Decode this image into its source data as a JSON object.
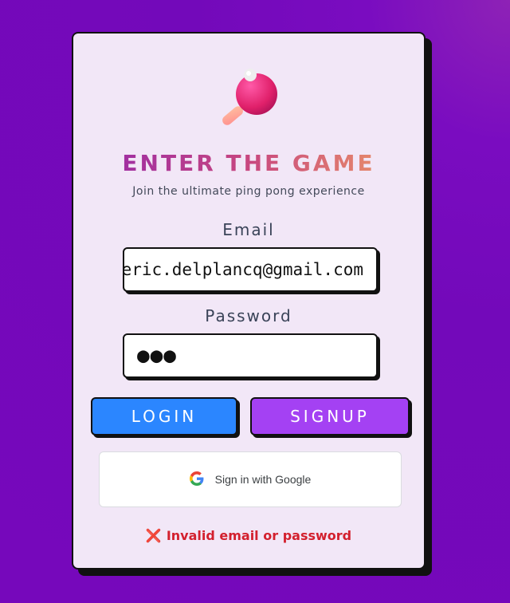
{
  "header": {
    "logo_icon": "ping-pong-paddle-icon",
    "title": "ENTER THE GAME",
    "subtitle": "Join the ultimate ping pong experience"
  },
  "form": {
    "email_label": "Email",
    "email_value": "eric.delplancq@gmail.com",
    "password_label": "Password",
    "password_value": "●●●"
  },
  "buttons": {
    "login_label": "LOGIN",
    "signup_label": "SIGNUP",
    "google_label": "Sign in with Google",
    "google_icon": "google-g-icon"
  },
  "status": {
    "error_icon": "❌",
    "error_text": "Invalid email or password"
  },
  "colors": {
    "login": "#2b86ff",
    "signup": "#a441f3",
    "error": "#d3202e",
    "background": "#7309ba"
  }
}
